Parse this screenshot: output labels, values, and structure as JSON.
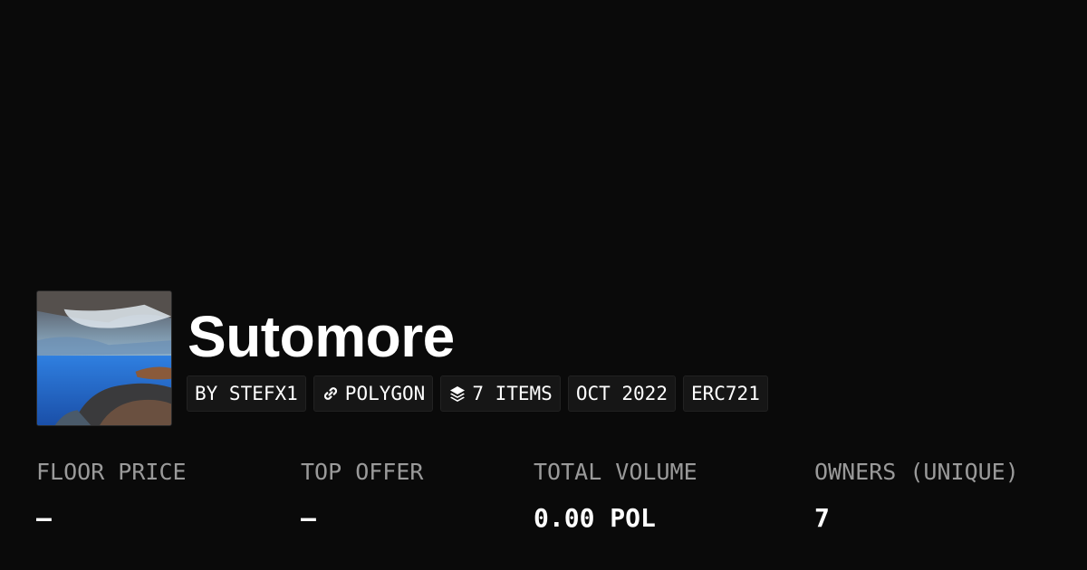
{
  "collection": {
    "title": "Sutomore",
    "image_alt": "collection artwork: blue sea and rocky coast painting"
  },
  "chips": {
    "creator": "BY STEFX1",
    "chain": "POLYGON",
    "items": "7 ITEMS",
    "date": "OCT 2022",
    "standard": "ERC721"
  },
  "icons": {
    "chain": "link-icon",
    "items": "layers-icon"
  },
  "stats": [
    {
      "label": "FLOOR PRICE",
      "value": "–"
    },
    {
      "label": "TOP OFFER",
      "value": "–"
    },
    {
      "label": "TOTAL VOLUME",
      "value": "0.00 POL"
    },
    {
      "label": "OWNERS (UNIQUE)",
      "value": "7"
    }
  ],
  "colors": {
    "background": "#0a0a0a",
    "chip_background": "#161616",
    "label": "#9a9a9a",
    "text": "#ffffff"
  }
}
